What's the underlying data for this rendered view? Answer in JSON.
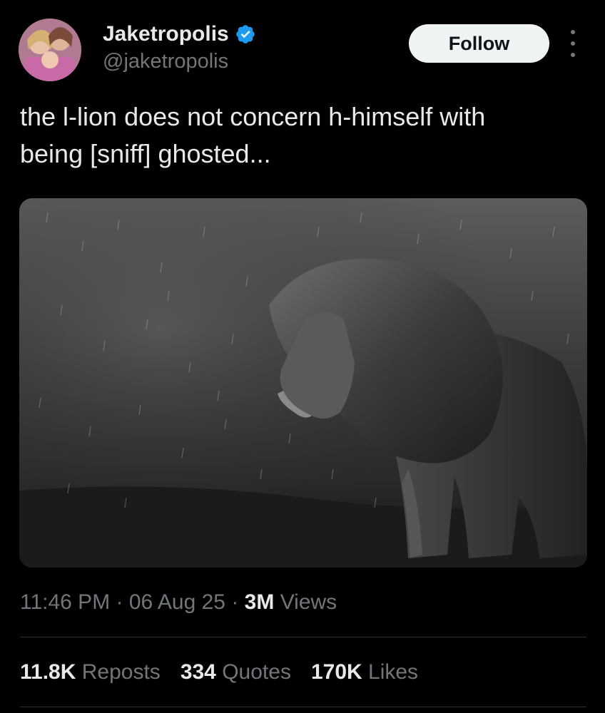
{
  "author": {
    "display_name": "Jaketropolis",
    "handle": "@jaketropolis",
    "verified_icon": "verified-badge-icon",
    "avatar_icon": "avatar-photo"
  },
  "actions": {
    "follow_label": "Follow",
    "more_icon": "more-options-icon"
  },
  "tweet": {
    "text_line1": "the l-lion does not concern h-himself with",
    "text_line2": "being [sniff] ghosted...",
    "media_description": "lion-in-rain-photo"
  },
  "meta": {
    "time": "11:46 PM",
    "sep1": " · ",
    "date": "06 Aug 25",
    "sep2": " · ",
    "views_count": "3M",
    "views_label": " Views"
  },
  "stats": [
    {
      "count": "11.8K",
      "label": "Reposts"
    },
    {
      "count": "334",
      "label": "Quotes"
    },
    {
      "count": "170K",
      "label": "Likes"
    }
  ],
  "colors": {
    "background": "#000000",
    "text_primary": "#e7e9ea",
    "text_secondary": "#71767b",
    "verified_blue": "#1d9bf0",
    "follow_bg": "#eff3f4",
    "divider": "#2f3336"
  }
}
